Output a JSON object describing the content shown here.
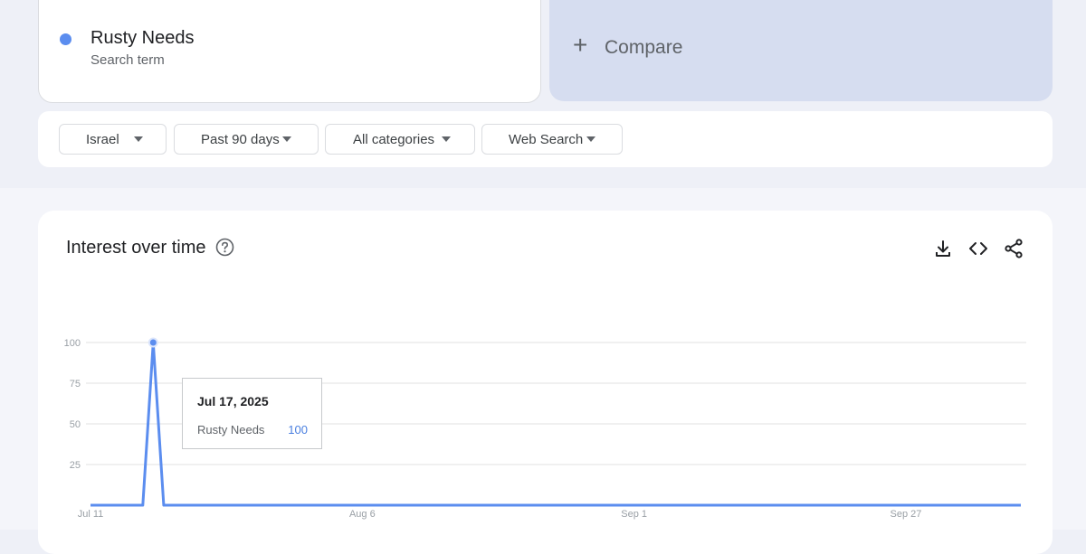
{
  "search_term": {
    "name": "Rusty Needs",
    "type": "Search term",
    "color": "#5b8def"
  },
  "compare": {
    "label": "Compare"
  },
  "filters": {
    "region": "Israel",
    "time_range": "Past 90 days",
    "category": "All categories",
    "property": "Web Search"
  },
  "interest_over_time": {
    "title": "Interest over time",
    "icons": [
      "help-icon",
      "download-icon",
      "embed-code-icon",
      "share-icon"
    ],
    "tooltip": {
      "date": "Jul 17, 2025",
      "term": "Rusty Needs",
      "value": "100"
    }
  },
  "chart_data": {
    "type": "line",
    "x_ticks": [
      "Jul 11",
      "Aug 6",
      "Sep 1",
      "Sep 27"
    ],
    "y_ticks": [
      "100",
      "75",
      "50",
      "25"
    ],
    "ylim": [
      0,
      100
    ],
    "grid": true,
    "x_start": "2025-07-11",
    "x_end": "2025-10-08",
    "series": [
      {
        "name": "Rusty Needs",
        "color": "#5b8def",
        "points": [
          [
            "2025-07-11",
            0
          ],
          [
            "2025-07-16",
            0
          ],
          [
            "2025-07-17",
            100
          ],
          [
            "2025-07-18",
            0
          ],
          [
            "2025-10-08",
            0
          ]
        ]
      }
    ]
  }
}
